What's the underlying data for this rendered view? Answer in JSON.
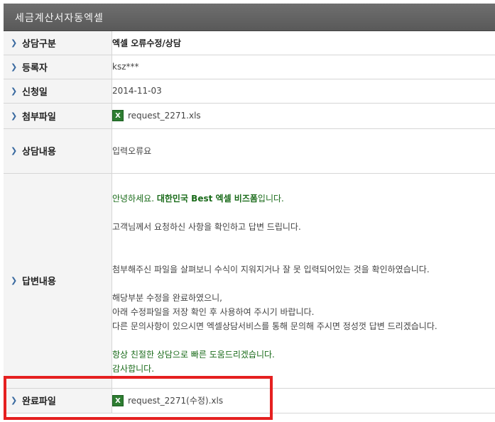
{
  "header": {
    "title": "세금계산서자동엑셀"
  },
  "rows": {
    "category": {
      "label": "상담구분",
      "value": "엑셀 오류수정/상담"
    },
    "author": {
      "label": "등록자",
      "value": "ksz***"
    },
    "date": {
      "label": "신청일",
      "value": "2014-11-03"
    },
    "attachment": {
      "label": "첨부파일",
      "file": "request_2271.xls",
      "icon": "excel-file-icon"
    },
    "content": {
      "label": "상담내용",
      "value": "입력오류요"
    },
    "answer": {
      "label": "답변내용",
      "greeting_pre": "안녕하세요. ",
      "greeting_brand": "대한민국 Best 엑셀 비즈폼",
      "greeting_post": "입니다.",
      "line1": "고객님께서 요청하신 사항을 확인하고 답변 드립니다.",
      "line2": "첨부해주신 파일을 살펴보니 수식이 지워지거나 잘 못 입력되어있는 것을 확인하였습니다.",
      "line3": "해당부분 수정을 완료하였으니,",
      "line4": "아래 수정파일을 저장 확인 후 사용하여 주시기 바랍니다.",
      "line5": "다른 문의사항이 있으시면 엑셀상담서비스를 통해 문의해 주시면 정성껏 답변 드리겠습니다.",
      "closing1": "항상 친절한 상담으로 빠른 도움드리겠습니다.",
      "closing2": "감사합니다."
    },
    "result": {
      "label": "완료파일",
      "file": "request_2271(수정).xls",
      "icon": "excel-file-icon"
    }
  },
  "colors": {
    "header_bg": "#5f5f5f",
    "highlight_box": "#e52020",
    "answer_green": "#1a6b1a"
  }
}
